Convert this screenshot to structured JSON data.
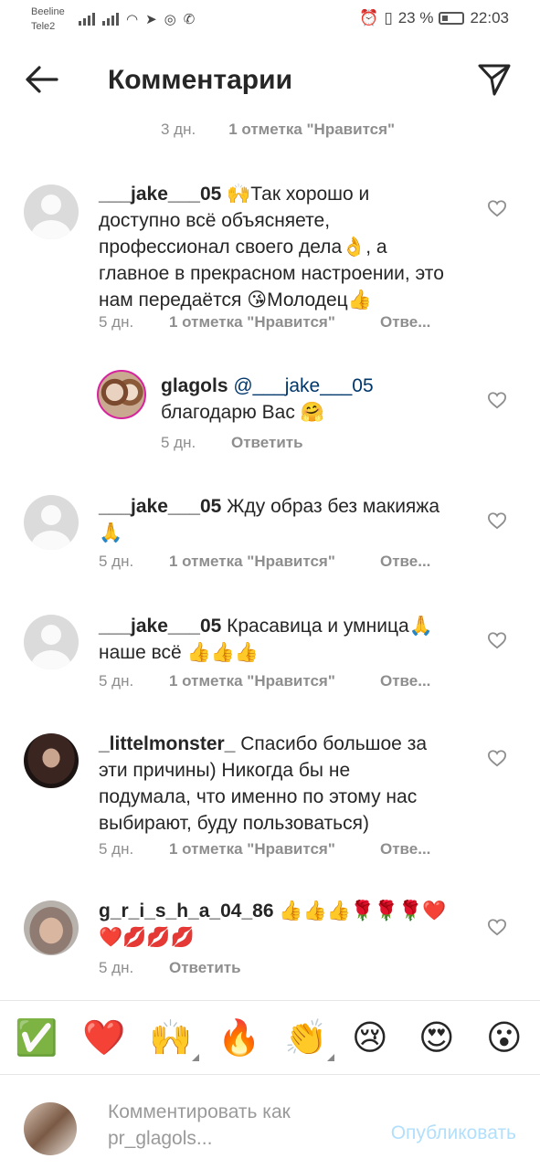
{
  "status": {
    "carrier1": "Beeline",
    "carrier2": "Tele2",
    "battery": "23 %",
    "time": "22:03"
  },
  "header": {
    "title": "Комментарии"
  },
  "post_meta": {
    "time": "3 дн.",
    "likes": "1 отметка \"Нравится\""
  },
  "comments": [
    {
      "username": "___jake___05",
      "text": " 🙌Так хорошо и доступно всё объясняете, профессионал своего дела👌, а главное в прекрасном настроении, это нам передаётся 😘Молодец👍",
      "time": "5 дн.",
      "likes": "1 отметка \"Нравится\"",
      "reply": "Отве..."
    },
    {
      "username": "glagols",
      "mention": "@___jake___05",
      "text": "благодарю Вас 🤗",
      "time": "5 дн.",
      "reply": "Ответить"
    },
    {
      "username": "___jake___05",
      "text": " Жду образ без макияжа 🙏",
      "time": "5 дн.",
      "likes": "1 отметка \"Нравится\"",
      "reply": "Отве..."
    },
    {
      "username": "___jake___05",
      "text": " Красавица и умница🙏 наше всё 👍👍👍",
      "time": "5 дн.",
      "likes": "1 отметка \"Нравится\"",
      "reply": "Отве..."
    },
    {
      "username": "_littelmonster_",
      "text": " Спасибо большое за эти причины) Никогда бы не подумала, что именно по этому нас выбирают, буду пользоваться)",
      "time": "5 дн.",
      "likes": "1 отметка \"Нравится\"",
      "reply": "Отве..."
    },
    {
      "username": "g_r_i_s_h_a_04_86",
      "text": " 👍👍👍🌹🌹🌹❤️❤️💋💋💋",
      "time": "5 дн.",
      "reply": "Ответить"
    }
  ],
  "emoji_bar": [
    "✅",
    "❤️",
    "🙌",
    "🔥",
    "👏",
    "😢",
    "😍",
    "😮"
  ],
  "composer": {
    "placeholder": "Комментировать как pr_glagols...",
    "publish": "Опубликовать"
  },
  "colors": {
    "link": "#00376b",
    "publish_disabled": "#b2dffc",
    "secondary_text": "#8e8e8e"
  }
}
